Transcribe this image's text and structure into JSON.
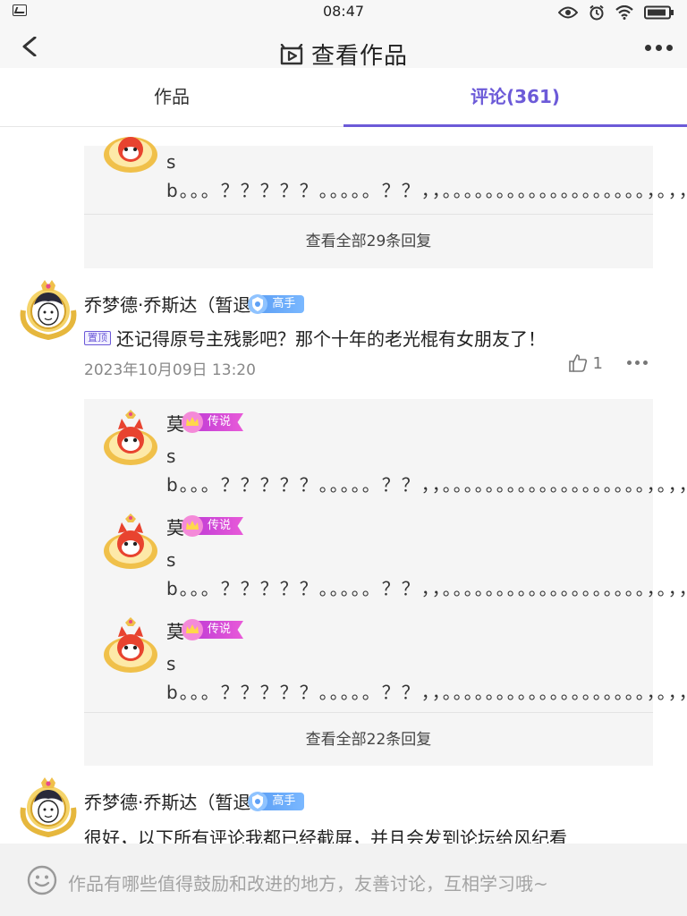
{
  "status_bar": {
    "time": "08:47"
  },
  "header": {
    "title": "查看作品"
  },
  "tabs": [
    {
      "label": "作品"
    },
    {
      "label": "评论(361)"
    }
  ],
  "top_replies": {
    "items": [
      {
        "text": "sb。。。？？？？？。。。。。？？，，。。。。。。。。。。。。。。。。。。。，。，，，"
      }
    ],
    "view_all": "查看全部29条回复"
  },
  "comment1": {
    "user": "乔梦德·乔斯达（暂退",
    "badge": "高手",
    "pinned_label": "置顶",
    "text": "还记得原号主残影吧？那个十年的老光棍有女朋友了！",
    "date": "2023年10月09日 13:20",
    "likes": "1",
    "replies": [
      {
        "name": "莫",
        "badge": "传说",
        "text": "sb。。。？？？？？。。。。。？？，，。。。。。。。。。。。。。。。。。。。，。，，，"
      },
      {
        "name": "莫",
        "badge": "传说",
        "text": "sb。。。？？？？？。。。。。？？，，。。。。。。。。。。。。。。。。。。。，。，，，"
      },
      {
        "name": "莫",
        "badge": "传说",
        "text": "sb。。。？？？？？。。。。。？？，，。。。。。。。。。。。。。。。。。。。，。，，，"
      }
    ],
    "view_all": "查看全部22条回复"
  },
  "comment2": {
    "user": "乔梦德·乔斯达（暂退",
    "badge": "高手",
    "text": "很好，以下所有评论我都已经截屏，并且会发到论坛给风纪看"
  },
  "input": {
    "placeholder": "作品有哪些值得鼓励和改进的地方，友善讨论，互相学习哦~"
  }
}
